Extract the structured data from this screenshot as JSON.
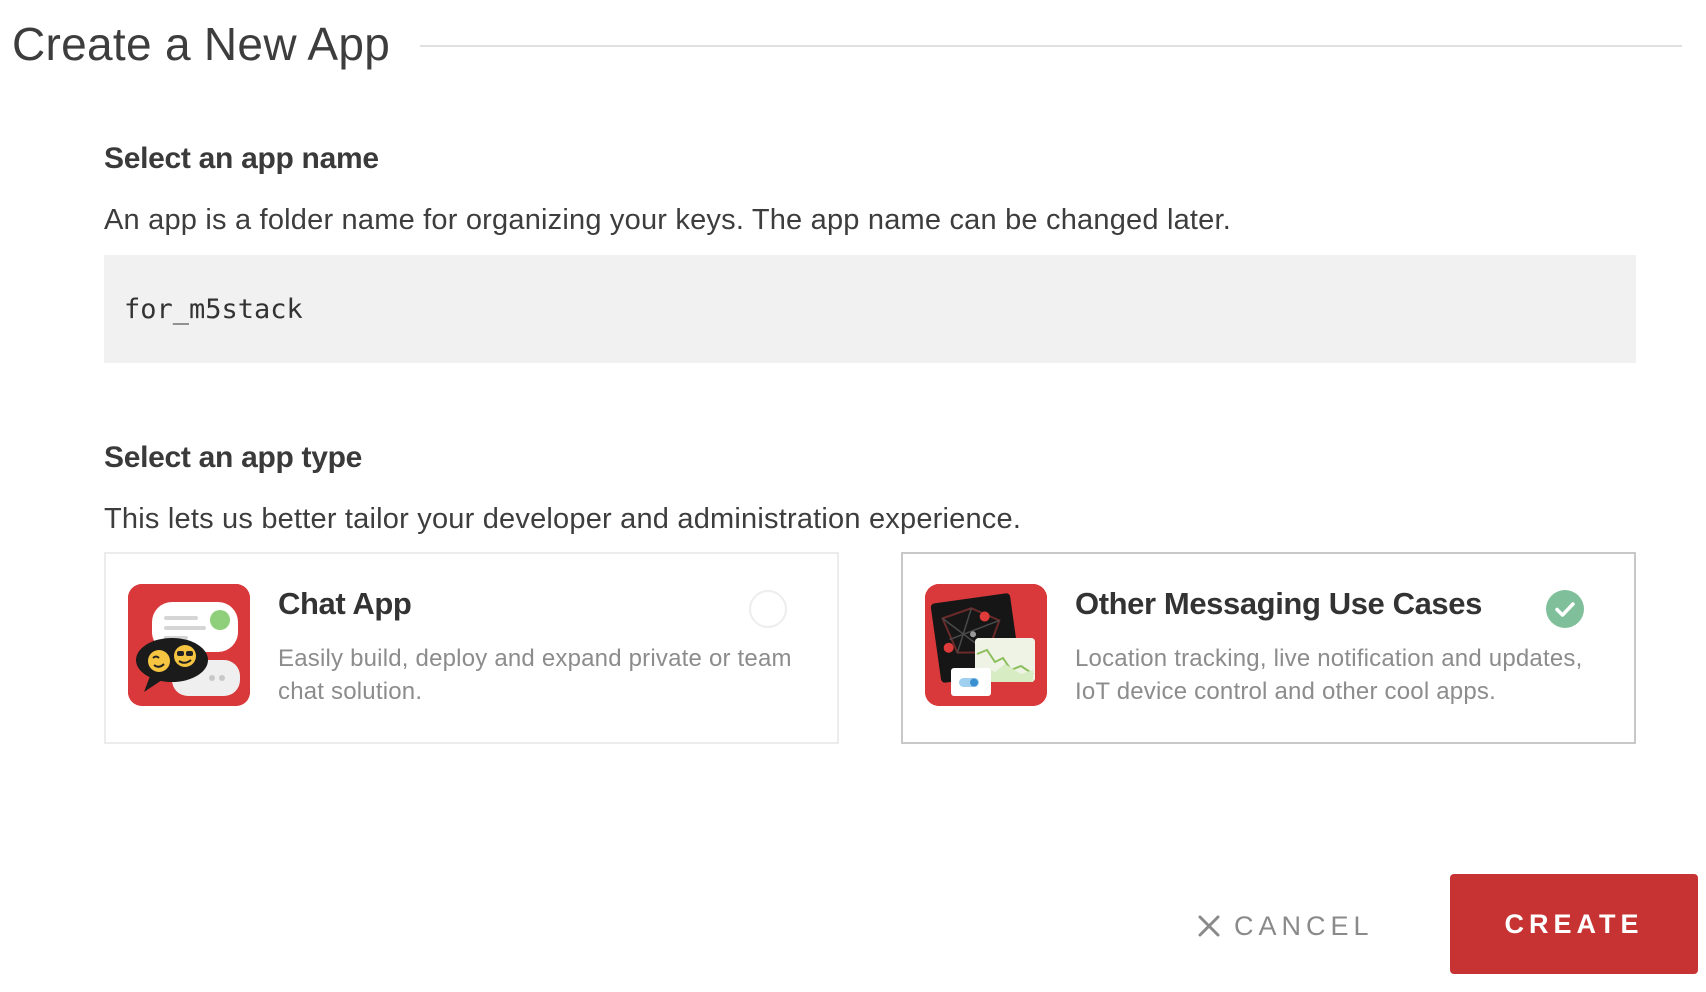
{
  "header": {
    "title": "Create a New App"
  },
  "app_name": {
    "heading": "Select an app name",
    "description": "An app is a folder name for organizing your keys. The app name can be changed later.",
    "value": "for_m5stack"
  },
  "app_type": {
    "heading": "Select an app type",
    "description": "This lets us better tailor your developer and administration experience.",
    "options": [
      {
        "title": "Chat App",
        "description": "Easily build, deploy and expand private or team chat solution.",
        "selected": false,
        "icon": "chat-bubbles-icon"
      },
      {
        "title": "Other Messaging Use Cases",
        "description": "Location tracking, live notification and updates, IoT device control and other cool apps.",
        "selected": true,
        "icon": "map-dashboard-icon"
      }
    ]
  },
  "actions": {
    "cancel_label": "CANCEL",
    "create_label": "CREATE"
  },
  "colors": {
    "accent": "#c73232",
    "check": "#7fbf9a",
    "input_bg": "#f1f1f1"
  }
}
